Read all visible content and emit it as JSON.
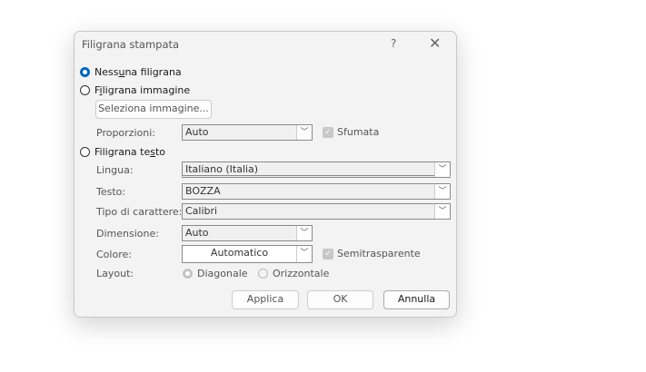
{
  "dialog": {
    "title": "Filigrana stampata",
    "help": "?",
    "close": "✕"
  },
  "options": {
    "none": {
      "pre": "Ness",
      "u": "u",
      "post": "na filigrana",
      "selected": true
    },
    "image": {
      "pre": "F",
      "u": "i",
      "post": "ligrana immagine",
      "selected": false
    },
    "text": {
      "pre": "Filigrana te",
      "u": "s",
      "post": "to",
      "selected": false
    }
  },
  "image": {
    "select_button": "Seleziona immagine...",
    "scale_label": "Proporzioni:",
    "scale_value": "Auto",
    "washout_label": "Sfumata",
    "washout_checked": true
  },
  "text": {
    "language_label": "Lingua:",
    "language_value": "Italiano (Italia)",
    "text_label": "Testo:",
    "text_value": "BOZZA",
    "font_label": "Tipo di carattere:",
    "font_value": "Calibri",
    "size_label": "Dimensione:",
    "size_value": "Auto",
    "color_label": "Colore:",
    "color_value": "Automatico",
    "semitransparent_label": "Semitrasparente",
    "semitransparent_checked": true,
    "layout_label": "Layout:",
    "layout_diagonal": "Diagonale",
    "layout_horizontal": "Orizzontale",
    "layout_selected": "Diagonale"
  },
  "buttons": {
    "apply": "Applica",
    "ok": "OK",
    "cancel": "Annulla"
  },
  "colors": {
    "accent": "#0067c0",
    "dialog_bg": "#f3f3f3"
  }
}
